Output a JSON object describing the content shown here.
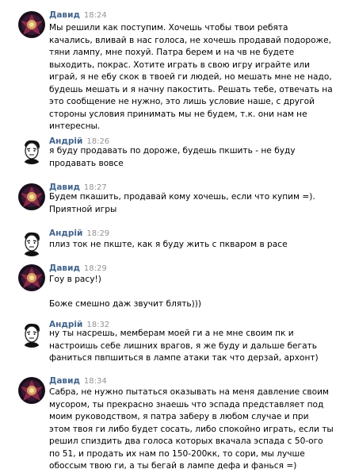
{
  "messages": [
    {
      "author": "Давид",
      "time": "18:24",
      "avatar": "david-avatar",
      "lines": [
        "Мы решили как поступим. Хочешь чтобы твои ребята",
        "качались, вливай в нас голоса, не хочешь продавай подороже,",
        "тяни лампу, мне похуй. Патра берем и на чв не будете",
        "выходить, покрас. Хотите играть в свою игру играйте или",
        "играй, я не ебу скок в твоей ги людей, но мешать мне не надо,",
        "будешь мешать и я начну пакостить. Решать тебе, отвечать на",
        "это сообщение не нужно, это лишь условие наше, с другой",
        "стороны условия принимать мы не будем, т.к. они нам не",
        "интересны."
      ]
    },
    {
      "author": "Андрій",
      "time": "18:26",
      "avatar": "andrii-avatar",
      "lines": [
        "я буду продавать по дороже, будешь пкшить - не буду",
        "продавать вовсе"
      ]
    },
    {
      "author": "Давид",
      "time": "18:27",
      "avatar": "david-avatar",
      "lines": [
        "Будем пкашить, продавай кому хочешь, если что купим =).",
        "Приятной игры"
      ]
    },
    {
      "author": "Андрій",
      "time": "18:29",
      "avatar": "andrii-avatar",
      "lines": [
        "плиз ток не пкште, как я буду жить с пкваром в расе"
      ]
    },
    {
      "author": "Давид",
      "time": "18:29",
      "avatar": "david-avatar",
      "lines": [
        "Гоу в расу!)",
        "",
        "Боже смешно даж звучит блять)))"
      ]
    },
    {
      "author": "Андрій",
      "time": "18:32",
      "avatar": "andrii-avatar",
      "lines": [
        "ну ты насрешь, мемберам моей ги а не мне своим пк и",
        "настроишь себе лишних врагов, я же буду и дальше бегать",
        "фаниться пвпшиться в лампе атаки так что дерзай, архонт)"
      ]
    },
    {
      "author": "Давид",
      "time": "18:34",
      "avatar": "david-avatar",
      "lines": [
        "Сабра, не нужно пытаться оказывать на меня давление своим",
        "мусором, ты прекрасно знаешь что эспада представляет под",
        "моим руководством, я патра заберу в любом случае и при",
        "этом твоя ги либо будет сосать, либо спокойно играть, если ты",
        "решил спиздить два голоса которых вкачала эспада с 50-ого",
        "по 51, и продать их нам по 150-200кк, то сори, мы лучше",
        "обоссым твою ги, а ты бегай в лампе дефа и фанься =)"
      ]
    }
  ]
}
